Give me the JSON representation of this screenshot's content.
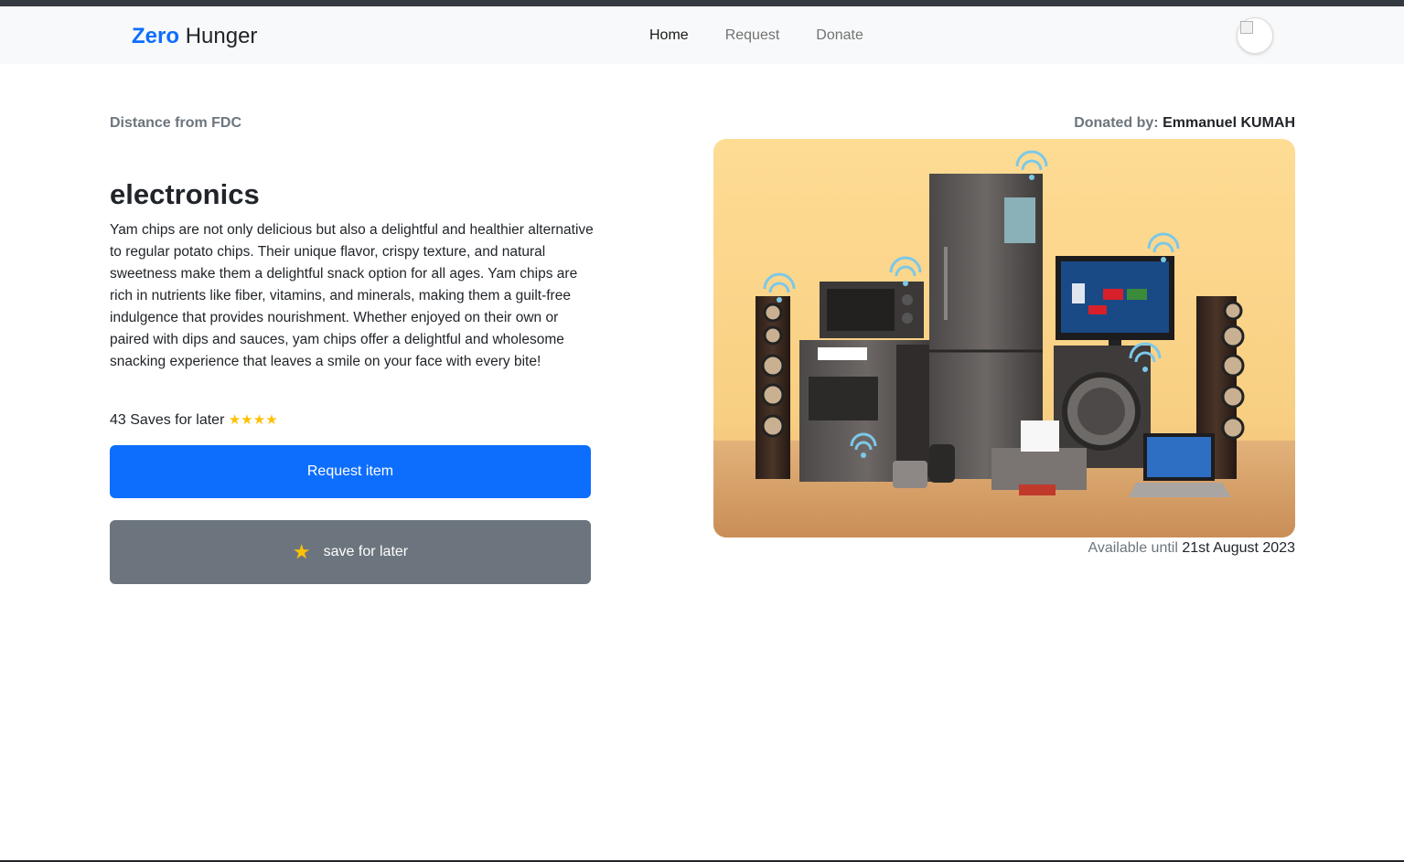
{
  "navbar": {
    "brand_zero": "Zero",
    "brand_hunger": "Hunger",
    "links": [
      {
        "label": "Home",
        "active": true
      },
      {
        "label": "Request",
        "active": false
      },
      {
        "label": "Donate",
        "active": false
      }
    ]
  },
  "item": {
    "distance_label": "Distance from FDC",
    "title": "electronics",
    "description": "Yam chips are not only delicious but also a delightful and healthier alternative to regular potato chips. Their unique flavor, crispy texture, and natural sweetness make them a delightful snack option for all ages. Yam chips are rich in nutrients like fiber, vitamins, and minerals, making them a guilt-free indulgence that provides nourishment. Whether enjoyed on their own or paired with dips and sauces, yam chips offer a delightful and wholesome snacking experience that leaves a smile on your face with every bite!",
    "saves_text": "43 Saves for later",
    "rating_stars": "★★★★",
    "request_label": "Request item",
    "save_label": "save for later",
    "save_icon": "★",
    "donated_by_label": "Donated by:",
    "donor_name": "Emmanuel KUMAH",
    "available_label": "Available until",
    "available_date": "21st August 2023"
  },
  "colors": {
    "primary": "#0d6efd",
    "secondary": "#6c757d",
    "star": "#ffc107",
    "image_background": "#fcd98f"
  }
}
